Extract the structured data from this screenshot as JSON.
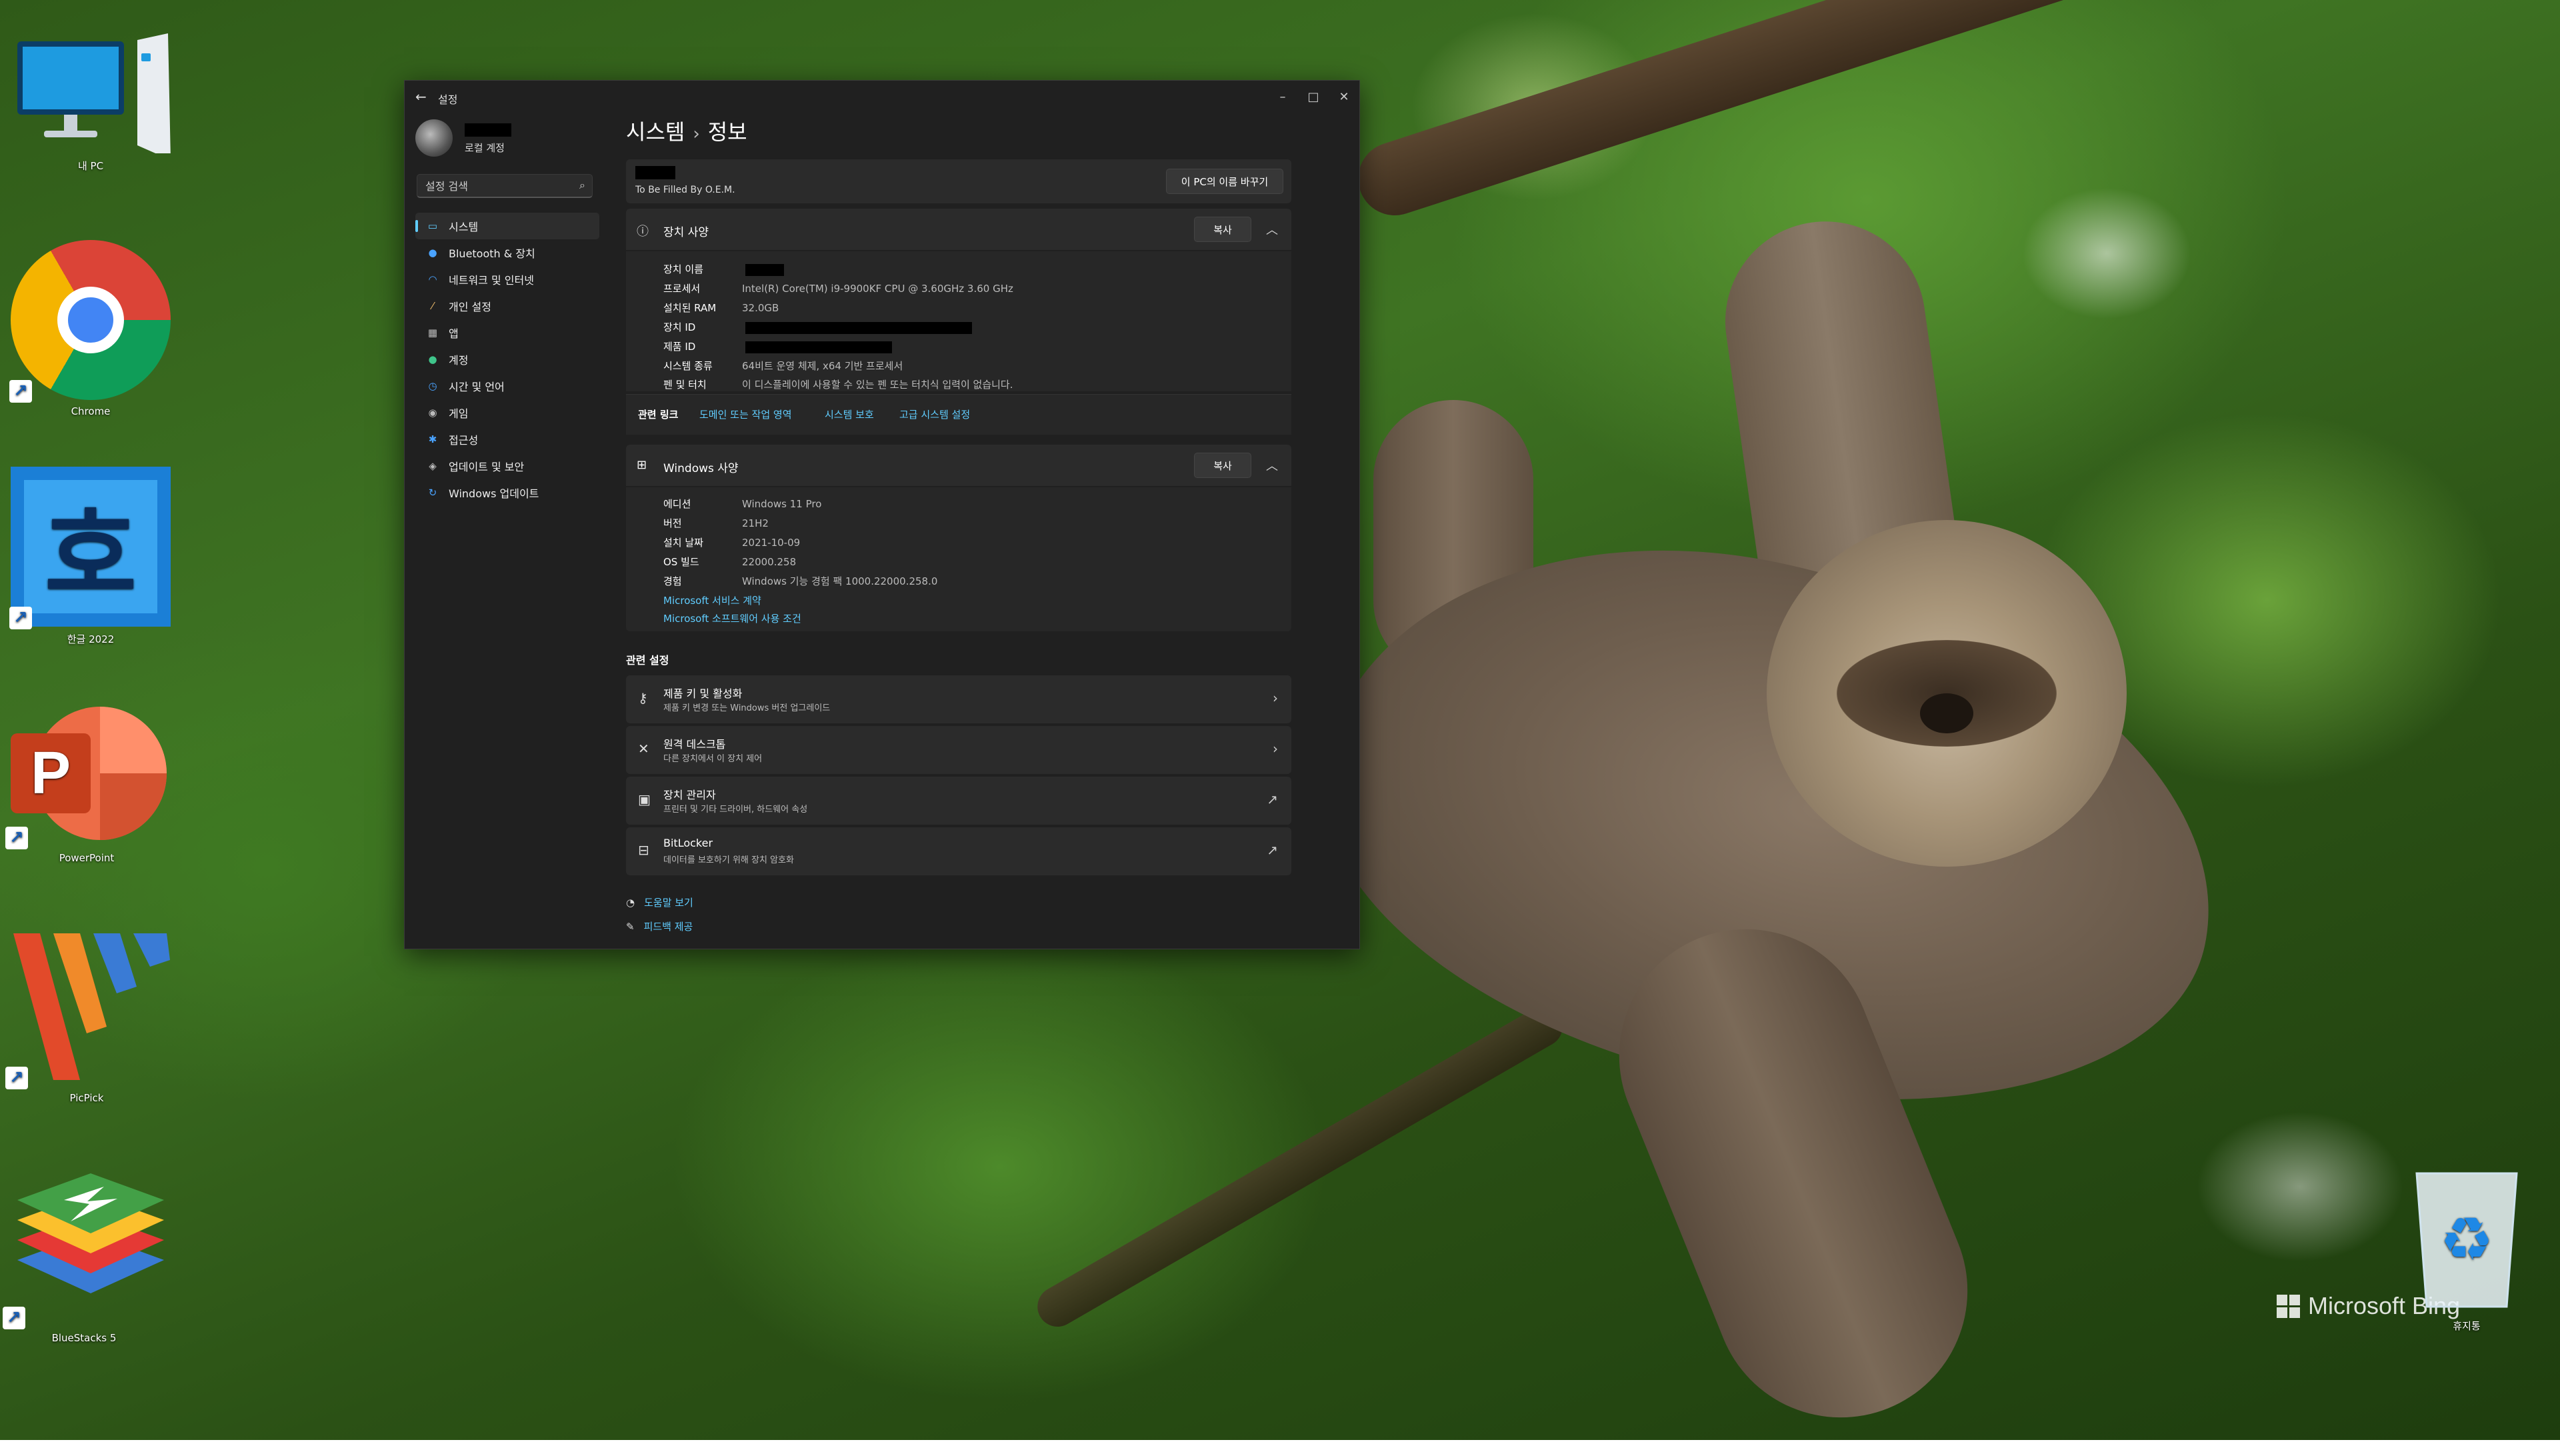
{
  "desktop": {
    "icons": [
      {
        "label": "내 PC"
      },
      {
        "label": "Chrome"
      },
      {
        "label": "한글 2022"
      },
      {
        "label": "PowerPoint"
      },
      {
        "label": "PicPick"
      },
      {
        "label": "BlueStacks 5"
      },
      {
        "label": "휴지통"
      }
    ],
    "watermark": "Microsoft Bing"
  },
  "window": {
    "title": "설정",
    "controls": {
      "minimize": "–",
      "maximize": "□",
      "close": "✕"
    },
    "back_glyph": "←"
  },
  "sidebar": {
    "account_label": "로컬 계정",
    "search_placeholder": "설정 검색",
    "items": [
      {
        "label": "시스템",
        "icon": "monitor-icon",
        "active": true
      },
      {
        "label": "Bluetooth & 장치",
        "icon": "bluetooth-icon"
      },
      {
        "label": "네트워크 및 인터넷",
        "icon": "wifi-icon"
      },
      {
        "label": "개인 설정",
        "icon": "brush-icon"
      },
      {
        "label": "앱",
        "icon": "apps-icon"
      },
      {
        "label": "계정",
        "icon": "person-icon"
      },
      {
        "label": "시간 및 언어",
        "icon": "globe-clock-icon"
      },
      {
        "label": "게임",
        "icon": "gamepad-icon"
      },
      {
        "label": "접근성",
        "icon": "accessibility-icon"
      },
      {
        "label": "업데이트 및 보안",
        "icon": "shield-icon"
      },
      {
        "label": "Windows 업데이트",
        "icon": "refresh-icon"
      }
    ]
  },
  "main": {
    "breadcrumb": {
      "parent": "시스템",
      "separator": "›",
      "current": "정보"
    },
    "pc_card": {
      "model": "To Be Filled By O.E.M.",
      "rename_button": "이 PC의 이름 바꾸기"
    },
    "device_specs": {
      "title": "장치 사양",
      "copy_button": "복사",
      "rows": [
        {
          "key": "장치 이름",
          "value": ""
        },
        {
          "key": "프로세서",
          "value": "Intel(R) Core(TM) i9-9900KF CPU @ 3.60GHz   3.60 GHz"
        },
        {
          "key": "설치된 RAM",
          "value": "32.0GB"
        },
        {
          "key": "장치 ID",
          "value": ""
        },
        {
          "key": "제품 ID",
          "value": ""
        },
        {
          "key": "시스템 종류",
          "value": "64비트 운영 체제, x64 기반 프로세서"
        },
        {
          "key": "펜 및 터치",
          "value": "이 디스플레이에 사용할 수 있는 펜 또는 터치식 입력이 없습니다."
        }
      ]
    },
    "related_links": {
      "label": "관련 링크",
      "links": [
        "도메인 또는 작업 영역",
        "시스템 보호",
        "고급 시스템 설정"
      ]
    },
    "windows_specs": {
      "title": "Windows 사양",
      "copy_button": "복사",
      "rows": [
        {
          "key": "에디션",
          "value": "Windows 11 Pro"
        },
        {
          "key": "버전",
          "value": "21H2"
        },
        {
          "key": "설치 날짜",
          "value": "2021-10-09"
        },
        {
          "key": "OS 빌드",
          "value": "22000.258"
        },
        {
          "key": "경험",
          "value": "Windows 기능 경험 팩 1000.22000.258.0"
        }
      ],
      "links": [
        "Microsoft 서비스 계약",
        "Microsoft 소프트웨어 사용 조건"
      ]
    },
    "related_settings": {
      "title": "관련 설정",
      "items": [
        {
          "title": "제품 키 및 활성화",
          "subtitle": "제품 키 변경 또는 Windows 버전 업그레이드",
          "icon": "key-icon",
          "action": "›"
        },
        {
          "title": "원격 데스크톱",
          "subtitle": "다른 장치에서 이 장치 제어",
          "icon": "remote-desktop-icon",
          "action": "›"
        },
        {
          "title": "장치 관리자",
          "subtitle": "프린터 및 기타 드라이버, 하드웨어 속성",
          "icon": "device-manager-icon",
          "action": "↗"
        },
        {
          "title": "BitLocker",
          "subtitle": "데이터를 보호하기 위해 장치 암호화",
          "icon": "bitlocker-icon",
          "action": "↗"
        }
      ]
    },
    "footer": {
      "help": "도움말 보기",
      "feedback": "피드백 제공"
    }
  }
}
